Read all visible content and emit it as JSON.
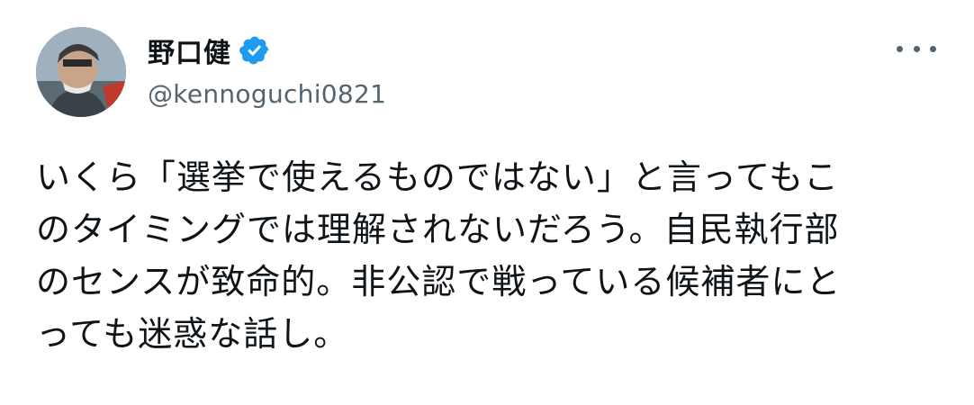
{
  "author": {
    "display_name": "野口健",
    "handle": "@kennoguchi0821",
    "verified": true,
    "verified_icon": "verified-badge-icon",
    "avatar_icon": "avatar"
  },
  "menu": {
    "icon": "more-icon"
  },
  "tweet": {
    "lines": [
      "いくら「選挙で使えるものではない」と言ってもこ",
      "のタイミングでは理解されないだろう。自民執行部",
      "のセンスが致命的。非公認で戦っている候補者にと",
      "っても迷惑な話し。"
    ]
  },
  "colors": {
    "text": "#0f1419",
    "secondary": "#536471",
    "verified": "#1d9bf0",
    "background": "#ffffff"
  }
}
